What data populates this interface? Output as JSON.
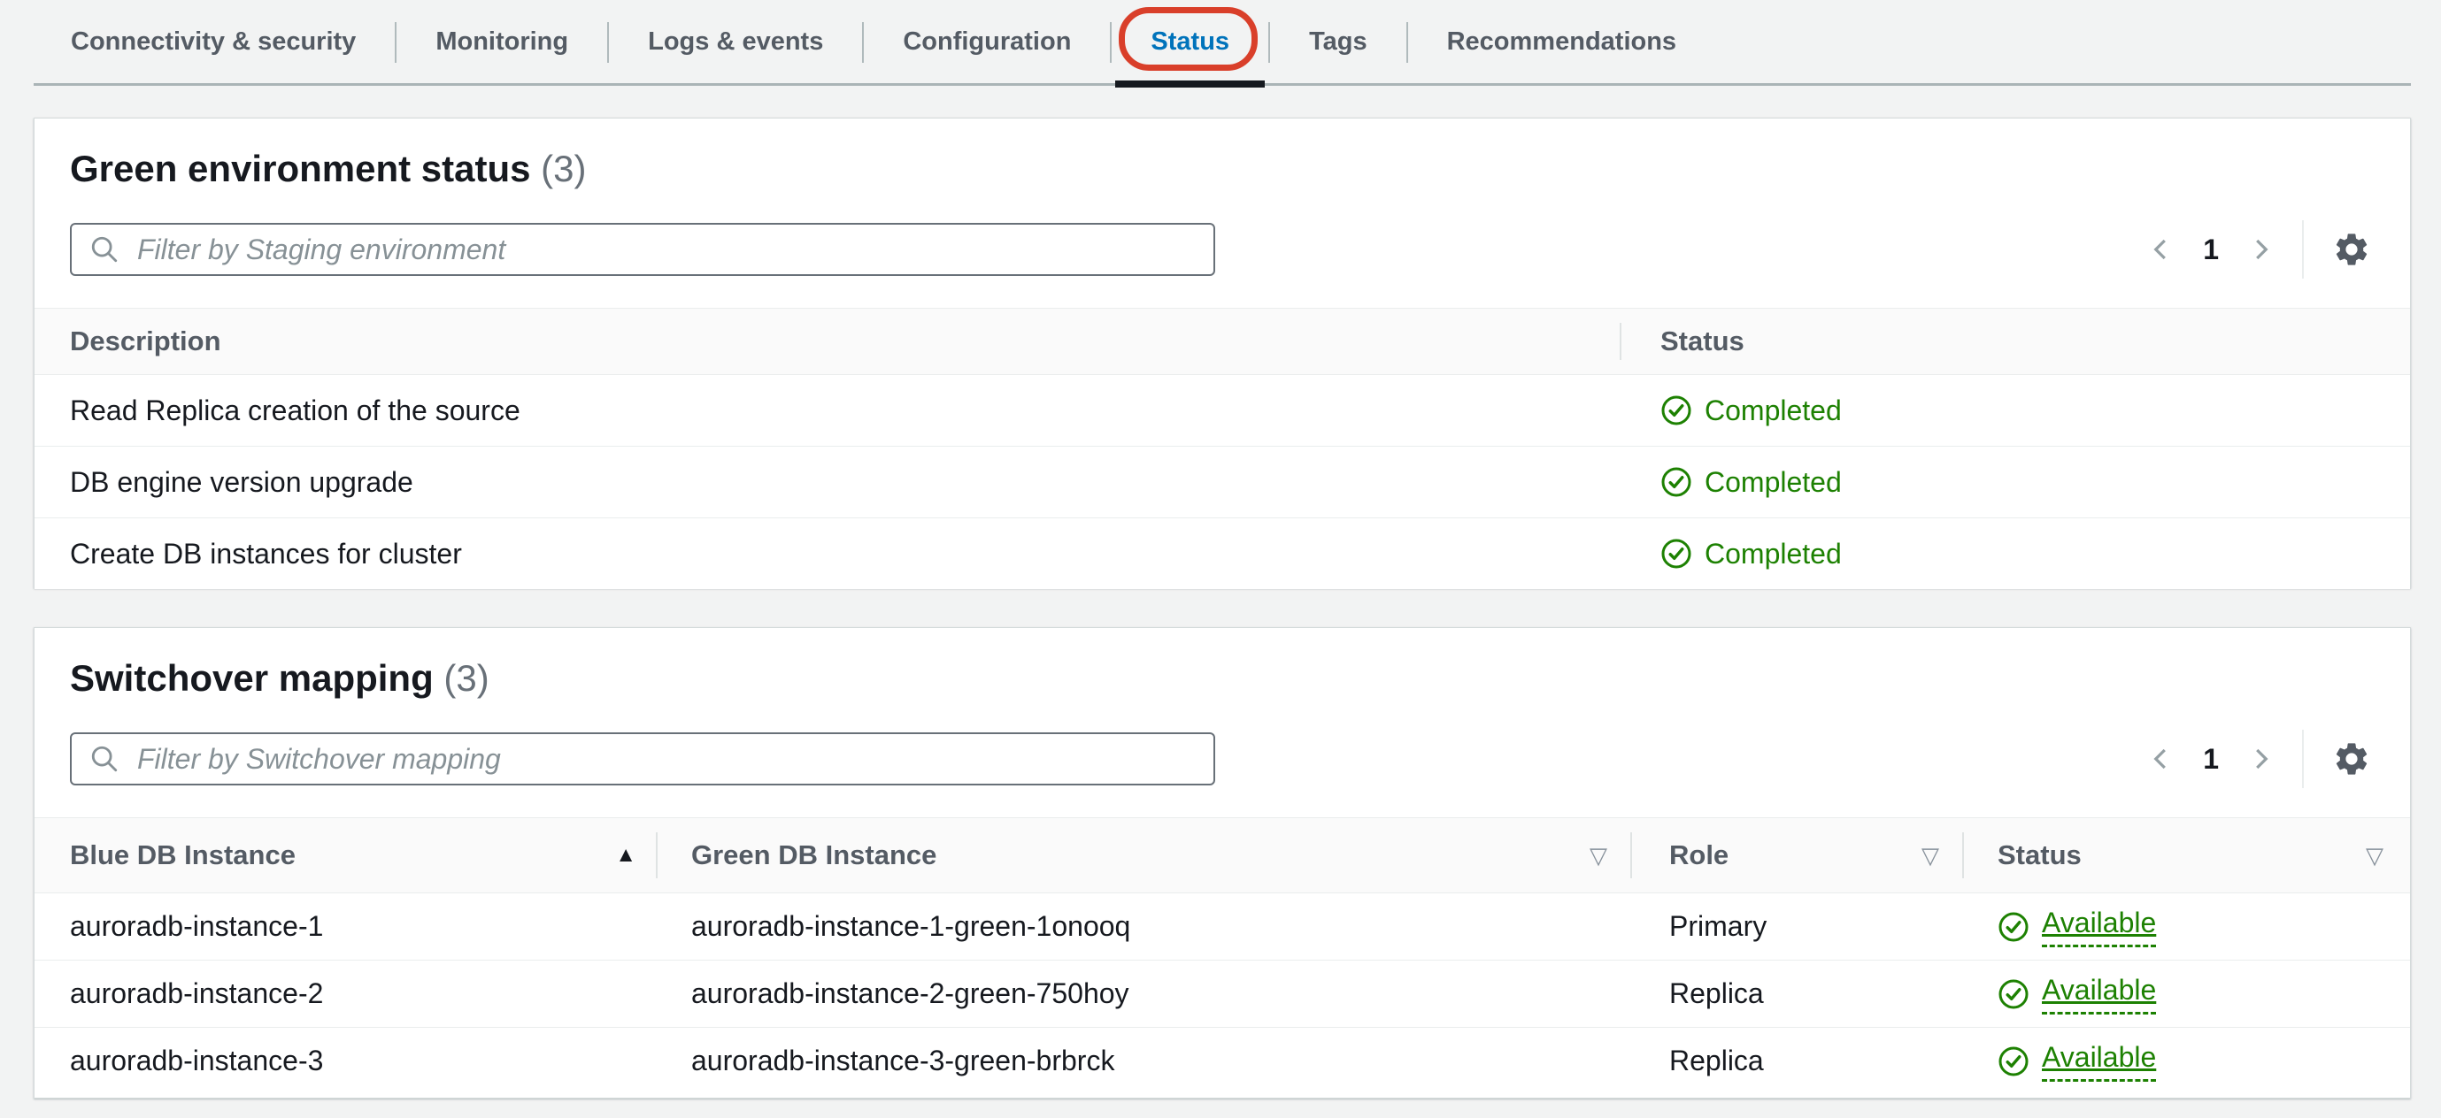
{
  "tabs": {
    "items": [
      {
        "label": "Connectivity & security"
      },
      {
        "label": "Monitoring"
      },
      {
        "label": "Logs & events"
      },
      {
        "label": "Configuration"
      },
      {
        "label": "Status",
        "active": true,
        "annotated": true
      },
      {
        "label": "Tags"
      },
      {
        "label": "Recommendations"
      }
    ]
  },
  "green_environment_status": {
    "title": "Green environment status",
    "count": "(3)",
    "filter_placeholder": "Filter by Staging environment",
    "pagination": {
      "current_page": "1"
    },
    "table": {
      "columns": [
        "Description",
        "Status"
      ],
      "rows": [
        {
          "description": "Read Replica creation of the source",
          "status": "Completed"
        },
        {
          "description": "DB engine version upgrade",
          "status": "Completed"
        },
        {
          "description": "Create DB instances for cluster",
          "status": "Completed"
        }
      ]
    }
  },
  "switchover_mapping": {
    "title": "Switchover mapping",
    "count": "(3)",
    "filter_placeholder": "Filter by Switchover mapping",
    "pagination": {
      "current_page": "1"
    },
    "table": {
      "columns": [
        {
          "label": "Blue DB Instance",
          "sort": "ascending"
        },
        {
          "label": "Green DB Instance",
          "sort": "none"
        },
        {
          "label": "Role",
          "sort": "none"
        },
        {
          "label": "Status",
          "sort": "none"
        }
      ],
      "rows": [
        {
          "blue": "auroradb-instance-1",
          "green": "auroradb-instance-1-green-1onooq",
          "role": "Primary",
          "status": "Available"
        },
        {
          "blue": "auroradb-instance-2",
          "green": "auroradb-instance-2-green-750hoy",
          "role": "Replica",
          "status": "Available"
        },
        {
          "blue": "auroradb-instance-3",
          "green": "auroradb-instance-3-green-brbrck",
          "role": "Replica",
          "status": "Available"
        }
      ]
    }
  },
  "icons": {
    "sort_ascending_glyph": "▲",
    "sort_toggle_glyph": "▽",
    "names": [
      "search-icon",
      "gear-icon",
      "chevron-left-icon",
      "chevron-right-icon",
      "check-circle-icon",
      "sort-ascending-icon",
      "sort-toggle-icon"
    ]
  },
  "colors": {
    "accent_blue": "#0073bb",
    "success_green": "#1d8102",
    "annotation_red": "#d93f2a",
    "tab_text": "#545b64",
    "active_underline": "#16191f"
  }
}
